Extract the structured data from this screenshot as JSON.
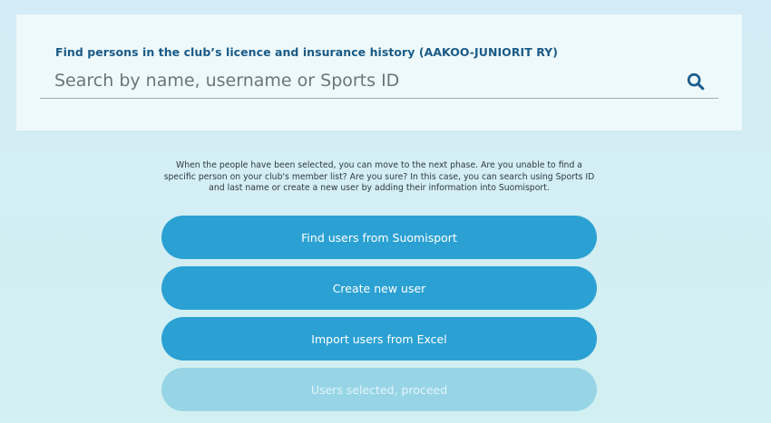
{
  "search": {
    "label": "Find persons in the club’s licence and insurance history (AAKOO-JUNIORIT RY)",
    "placeholder": "Search by name, username or Sports ID",
    "value": "",
    "icon": "search-icon"
  },
  "info": {
    "text": "When the people have been selected, you can move to the next phase. Are you unable to find a specific person on your club's member list? Are you sure? In this case, you can search using Sports ID and last name or create a new user by adding their information into Suomisport."
  },
  "actions": {
    "find_users_label": "Find users from Suomisport",
    "create_user_label": "Create new user",
    "import_users_label": "Import users from Excel",
    "proceed_label": "Users selected, proceed"
  },
  "colors": {
    "primary": "#2ba1d3",
    "disabled": "#97d5e6",
    "label": "#1a5a86",
    "icon": "#1b5d8c"
  }
}
